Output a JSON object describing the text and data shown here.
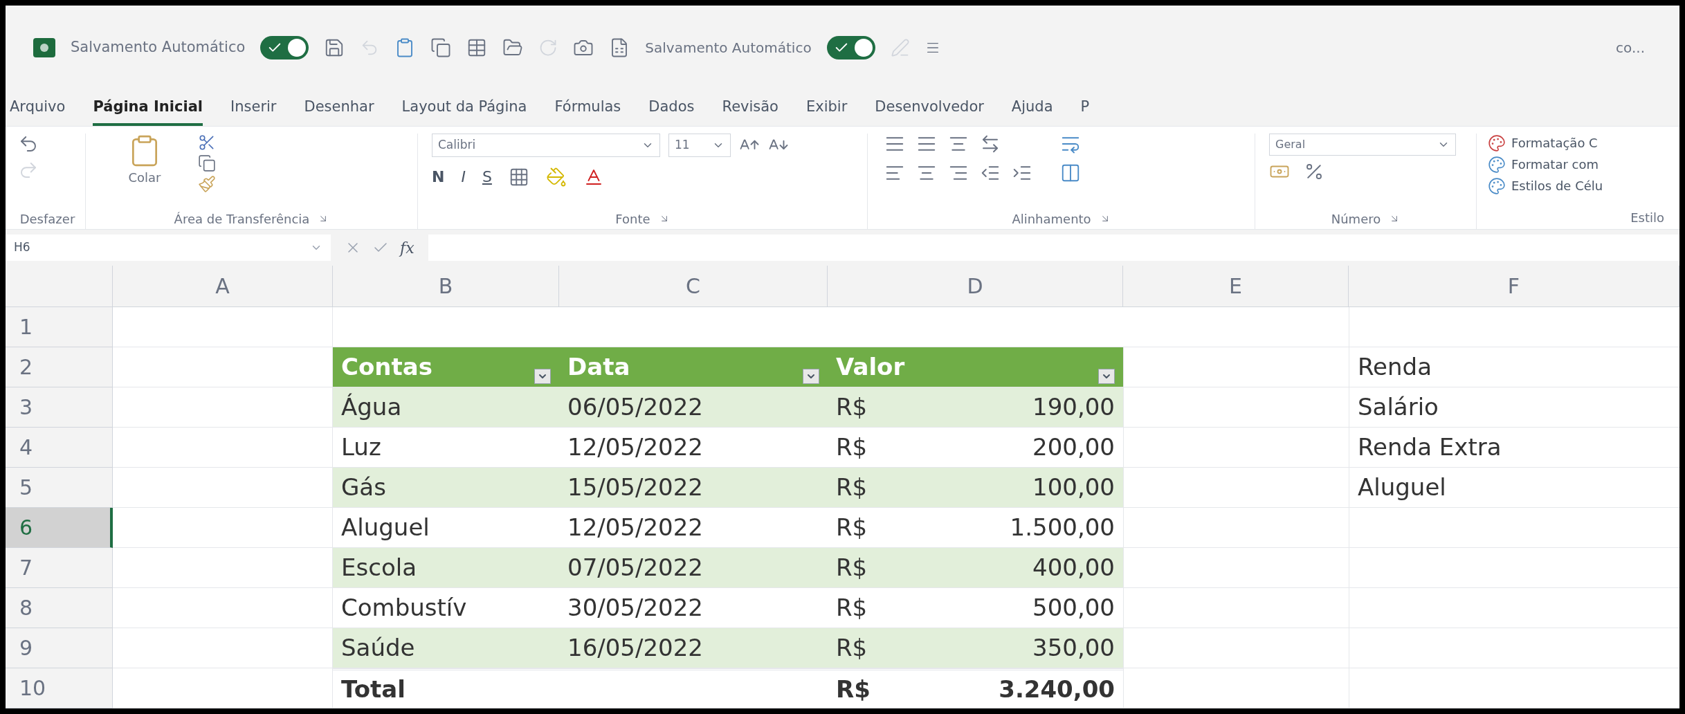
{
  "title_bar": {
    "autosave_label": "Salvamento Automático",
    "autosave_on": true,
    "autosave_label_2": "Salvamento Automático",
    "autosave_on_2": true,
    "file_name": "co..."
  },
  "tabs": [
    {
      "label": "Arquivo",
      "selected": false
    },
    {
      "label": "Página Inicial",
      "selected": true
    },
    {
      "label": "Inserir",
      "selected": false
    },
    {
      "label": "Desenhar",
      "selected": false
    },
    {
      "label": "Layout da Página",
      "selected": false
    },
    {
      "label": "Fórmulas",
      "selected": false
    },
    {
      "label": "Dados",
      "selected": false
    },
    {
      "label": "Revisão",
      "selected": false
    },
    {
      "label": "Exibir",
      "selected": false
    },
    {
      "label": "Desenvolvedor",
      "selected": false
    },
    {
      "label": "Ajuda",
      "selected": false
    },
    {
      "label": "P",
      "selected": false
    }
  ],
  "ribbon": {
    "undo_group": "Desfazer",
    "clipboard_group": "Área de Transferência",
    "paste_label": "Colar",
    "font_group": "Fonte",
    "font_name": "Calibri",
    "font_size": "11",
    "bold": "N",
    "italic": "I",
    "underline": "S",
    "alignment_group": "Alinhamento",
    "number_group": "Número",
    "number_format": "Geral",
    "styles": [
      "Formatação C",
      "Formatar com",
      "Estilos de Célu"
    ],
    "styles_group": "Estilo"
  },
  "formula_bar": {
    "name_box": "H6",
    "fx": "fx"
  },
  "sheet": {
    "columns": [
      "A",
      "B",
      "C",
      "D",
      "E",
      "F"
    ],
    "rows": [
      {
        "number": "1",
        "selected": false,
        "kind": "empty"
      },
      {
        "number": "2",
        "selected": false,
        "kind": "header",
        "contas": "Contas",
        "data": "Data",
        "valor": "Valor",
        "side": "Renda"
      },
      {
        "number": "3",
        "selected": false,
        "kind": "band",
        "contas": "Água",
        "data": "06/05/2022",
        "currency": "R$",
        "amount": "190,00",
        "side": "Salário"
      },
      {
        "number": "4",
        "selected": false,
        "kind": "plain",
        "contas": "Luz",
        "data": "12/05/2022",
        "currency": "R$",
        "amount": "200,00",
        "side": "Renda Extra"
      },
      {
        "number": "5",
        "selected": false,
        "kind": "band",
        "contas": "Gás",
        "data": "15/05/2022",
        "currency": "R$",
        "amount": "100,00",
        "side": "Aluguel"
      },
      {
        "number": "6",
        "selected": true,
        "kind": "plain",
        "contas": "Aluguel",
        "data": "12/05/2022",
        "currency": "R$",
        "amount": "1.500,00"
      },
      {
        "number": "7",
        "selected": false,
        "kind": "band",
        "contas": "Escola",
        "data": "07/05/2022",
        "currency": "R$",
        "amount": "400,00"
      },
      {
        "number": "8",
        "selected": false,
        "kind": "plain",
        "contas": "Combustív",
        "data": "30/05/2022",
        "currency": "R$",
        "amount": "500,00"
      },
      {
        "number": "9",
        "selected": false,
        "kind": "band",
        "contas": "Saúde",
        "data": "16/05/2022",
        "currency": "R$",
        "amount": "350,00"
      },
      {
        "number": "10",
        "selected": false,
        "kind": "total",
        "contas": "Total",
        "currency": "R$",
        "amount": "3.240,00"
      }
    ]
  }
}
